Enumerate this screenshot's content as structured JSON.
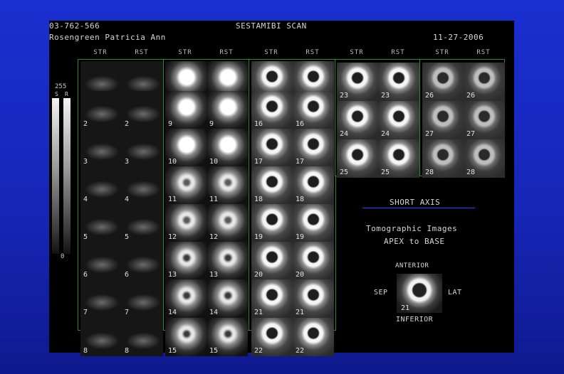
{
  "header": {
    "patient_id": "03-762-566",
    "patient_name": "Rosengreen Patricia Ann",
    "scan_title": "SESTAMIBI SCAN",
    "date": "11-27-2006"
  },
  "column_labels": [
    "STR",
    "RST",
    "STR",
    "RST",
    "STR",
    "RST",
    "STR",
    "RST",
    "STR",
    "RST"
  ],
  "color_scale": {
    "max_label": "255",
    "bar_labels": [
      "S",
      "R"
    ],
    "min_label": "0"
  },
  "groups": [
    {
      "rows": [
        [
          "",
          "",
          ""
        ],
        [
          "2",
          "2"
        ],
        [
          "3",
          "3"
        ],
        [
          "4",
          "4"
        ],
        [
          "5",
          "5"
        ],
        [
          "6",
          "6"
        ],
        [
          "7",
          "7"
        ],
        [
          "8",
          "8"
        ]
      ],
      "style": "faint"
    },
    {
      "rows": [
        [
          "",
          ""
        ],
        [
          "9",
          "9"
        ],
        [
          "10",
          "10"
        ],
        [
          "11",
          "11"
        ],
        [
          "12",
          "12"
        ],
        [
          "13",
          "13"
        ],
        [
          "14",
          "14"
        ],
        [
          "15",
          "15"
        ]
      ],
      "style": "blob"
    },
    {
      "rows": [
        [
          "",
          ""
        ],
        [
          "16",
          "16"
        ],
        [
          "17",
          "17"
        ],
        [
          "18",
          "18"
        ],
        [
          "19",
          "19"
        ],
        [
          "20",
          "20"
        ],
        [
          "21",
          "21"
        ],
        [
          "22",
          "22"
        ]
      ],
      "style": "ring"
    },
    {
      "rows": [
        [
          "23",
          "23"
        ],
        [
          "24",
          "24"
        ],
        [
          "25",
          "25"
        ]
      ],
      "style": "ring"
    },
    {
      "rows": [
        [
          "26",
          "26"
        ],
        [
          "27",
          "27"
        ],
        [
          "28",
          "28"
        ]
      ],
      "style": "ringfade"
    }
  ],
  "short_axis": {
    "title": "SHORT AXIS",
    "subtitle_1": "Tomographic Images",
    "subtitle_2": "APEX to BASE",
    "orientation": {
      "top": "ANTERIOR",
      "left": "SEP",
      "right": "LAT",
      "bottom": "INFERIOR",
      "slice": "21"
    }
  }
}
